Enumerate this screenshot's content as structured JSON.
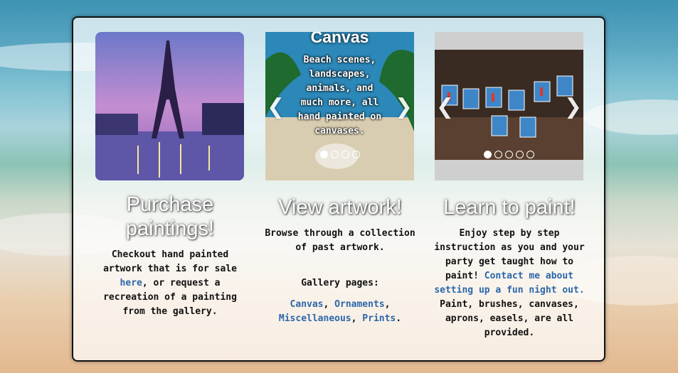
{
  "columns": [
    {
      "heading": "Purchase paintings!",
      "text_before_link": "Checkout hand painted artwork that is for sale ",
      "link": "here",
      "text_after_link": ", or request a recreation of a painting from the gallery."
    },
    {
      "slide_title": "Canvas",
      "slide_caption": "Beach scenes, landscapes, animals, and much more, all hand painted on canvases.",
      "heading": "View artwork!",
      "para1": "Browse through a collection of past artwork.",
      "para2": "Gallery pages:",
      "links": [
        "Canvas",
        "Ornaments",
        "Miscellaneous",
        "Prints"
      ],
      "slider_dots": 4
    },
    {
      "heading": "Learn to paint!",
      "text_before_link": "Enjoy step by step instruction as you and your party get taught how to paint! ",
      "link": "Contact me about setting up a fun night out.",
      "text_after_link": " Paint, brushes, canvases, aprons, easels, are all provided.",
      "slider_dots": 5
    }
  ],
  "colors": {
    "link": "#2c67a9",
    "heading": "#ffffff"
  }
}
